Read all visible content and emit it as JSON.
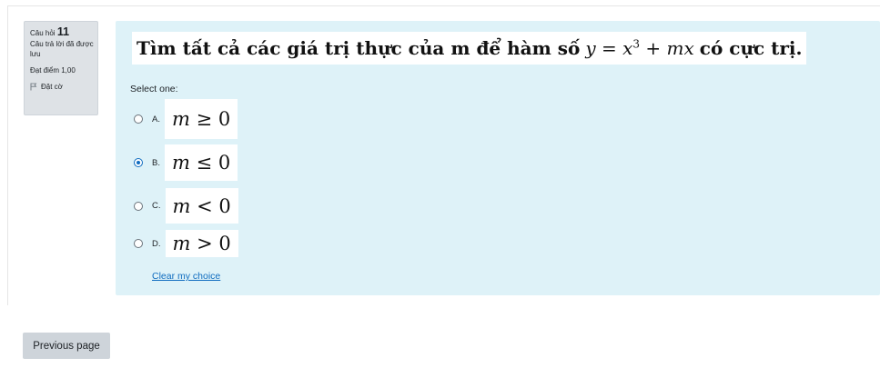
{
  "question_info": {
    "number_label": "Câu hỏi",
    "number": "11",
    "state": "Câu trả lời đã được lưu",
    "grade": "Đạt điểm 1,00",
    "flag_label": "Đặt cờ"
  },
  "question": {
    "text_before": "Tìm tất cả các giá trị thực của m để hàm số",
    "formula_lhs": "y",
    "formula_eq": "=",
    "formula_x": "x",
    "formula_exp": "3",
    "formula_plus": "+",
    "formula_mx": "mx",
    "text_after": "có cực trị."
  },
  "prompt": "Select one:",
  "options": [
    {
      "letter": "A.",
      "var": "m",
      "rel": "≥",
      "num": "0",
      "selected": false
    },
    {
      "letter": "B.",
      "var": "m",
      "rel": "≤",
      "num": "0",
      "selected": true
    },
    {
      "letter": "C.",
      "var": "m",
      "rel": "<",
      "num": "0",
      "selected": false
    },
    {
      "letter": "D.",
      "var": "m",
      "rel": ">",
      "num": "0",
      "selected": false
    }
  ],
  "clear_label": "Clear my choice",
  "previous_label": "Previous page",
  "colors": {
    "content_bg": "#def2f8",
    "info_bg": "#dee2e6",
    "link": "#0f6cbf",
    "button_bg": "#ced4da"
  },
  "icons": {
    "flag": "flag-icon",
    "radio": "radio-icon"
  }
}
